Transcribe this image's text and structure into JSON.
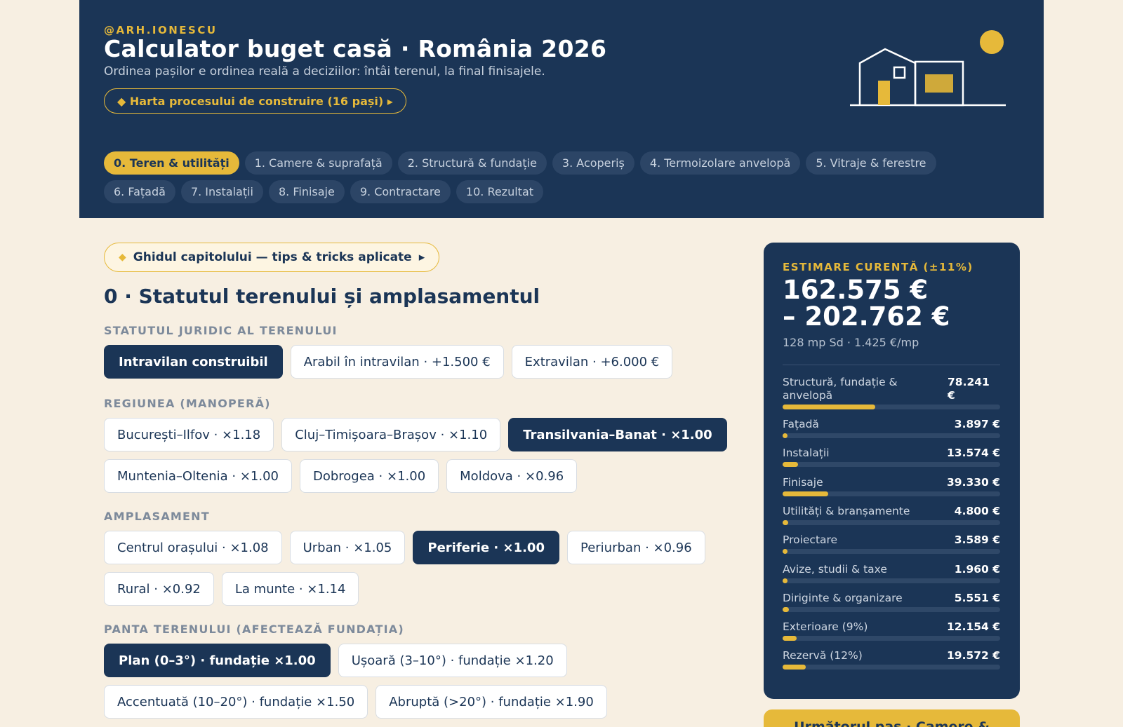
{
  "header": {
    "handle": "@ARH.IONESCU",
    "title": "Calculator buget casă · România 2026",
    "subtitle": "Ordinea pașilor e ordinea reală a deciziilor: întâi terenul, la final finisajele.",
    "process_map": "◆ Harta procesului de construire (16 pași) ▸"
  },
  "steps": [
    {
      "label": "0. Teren & utilități",
      "active": true
    },
    {
      "label": "1. Camere & suprafață"
    },
    {
      "label": "2. Structură & fundație"
    },
    {
      "label": "3. Acoperiș"
    },
    {
      "label": "4. Termoizolare anvelopă"
    },
    {
      "label": "5. Vitraje & ferestre"
    },
    {
      "label": "6. Fațadă"
    },
    {
      "label": "7. Instalații"
    },
    {
      "label": "8. Finisaje"
    },
    {
      "label": "9. Contractare"
    },
    {
      "label": "10. Rezultat"
    }
  ],
  "guide": {
    "icon": "diamond-icon",
    "label": "Ghidul capitolului — tips & tricks aplicate",
    "arrow": "▸"
  },
  "section_title": "0 · Statutul terenului și amplasamentul",
  "groups": {
    "legal": {
      "label": "STATUTUL JURIDIC AL TERENULUI",
      "options": [
        "Intravilan construibil",
        "Arabil în intravilan · +1.500 €",
        "Extravilan · +6.000 €"
      ],
      "selected": "Intravilan construibil"
    },
    "region": {
      "label": "REGIUNEA (MANOPERĂ)",
      "options": [
        "București–Ilfov · ×1.18",
        "Cluj–Timișoara–Brașov · ×1.10",
        "Transilvania–Banat · ×1.00",
        "Muntenia–Oltenia · ×1.00",
        "Dobrogea · ×1.00",
        "Moldova · ×0.96"
      ],
      "selected": "Transilvania–Banat · ×1.00"
    },
    "location": {
      "label": "AMPLASAMENT",
      "options": [
        "Centrul orașului · ×1.08",
        "Urban · ×1.05",
        "Periferie · ×1.00",
        "Periurban · ×0.96",
        "Rural · ×0.92",
        "La munte · ×1.14"
      ],
      "selected": "Periferie · ×1.00"
    },
    "slope": {
      "label": "PANTA TERENULUI (AFECTEAZĂ FUNDAȚIA)",
      "options": [
        "Plan (0–3°) · fundație ×1.00",
        "Ușoară (3–10°) · fundație ×1.20",
        "Accentuată (10–20°) · fundație ×1.50",
        "Abruptă (>20°) · fundație ×1.90"
      ],
      "selected": "Plan (0–3°) · fundație ×1.00"
    }
  },
  "estimate": {
    "label": "ESTIMARE CURENTĂ (±11%)",
    "low": "162.575 €",
    "high": "– 202.762 €",
    "sub": "128 mp Sd · 1.425 €/mp",
    "items": [
      {
        "name": "Structură, fundație & anvelopă",
        "value": "78.241 €",
        "share": 0.425
      },
      {
        "name": "Fațadă",
        "value": "3.897 €",
        "share": 0.02
      },
      {
        "name": "Instalații",
        "value": "13.574 €",
        "share": 0.07
      },
      {
        "name": "Finisaje",
        "value": "39.330 €",
        "share": 0.21
      },
      {
        "name": "Utilități & branșamente",
        "value": "4.800 €",
        "share": 0.025
      },
      {
        "name": "Proiectare",
        "value": "3.589 €",
        "share": 0.018
      },
      {
        "name": "Avize, studii & taxe",
        "value": "1.960 €",
        "share": 0.012
      },
      {
        "name": "Diriginte & organizare",
        "value": "5.551 €",
        "share": 0.03
      },
      {
        "name": "Exterioare (9%)",
        "value": "12.154 €",
        "share": 0.065
      },
      {
        "name": "Rezervă (12%)",
        "value": "19.572 €",
        "share": 0.105
      }
    ]
  },
  "next_button": "Următorul pas · Camere &",
  "colors": {
    "navy": "#1b3556",
    "accent": "#e6b93a",
    "background": "#f7efe2"
  }
}
